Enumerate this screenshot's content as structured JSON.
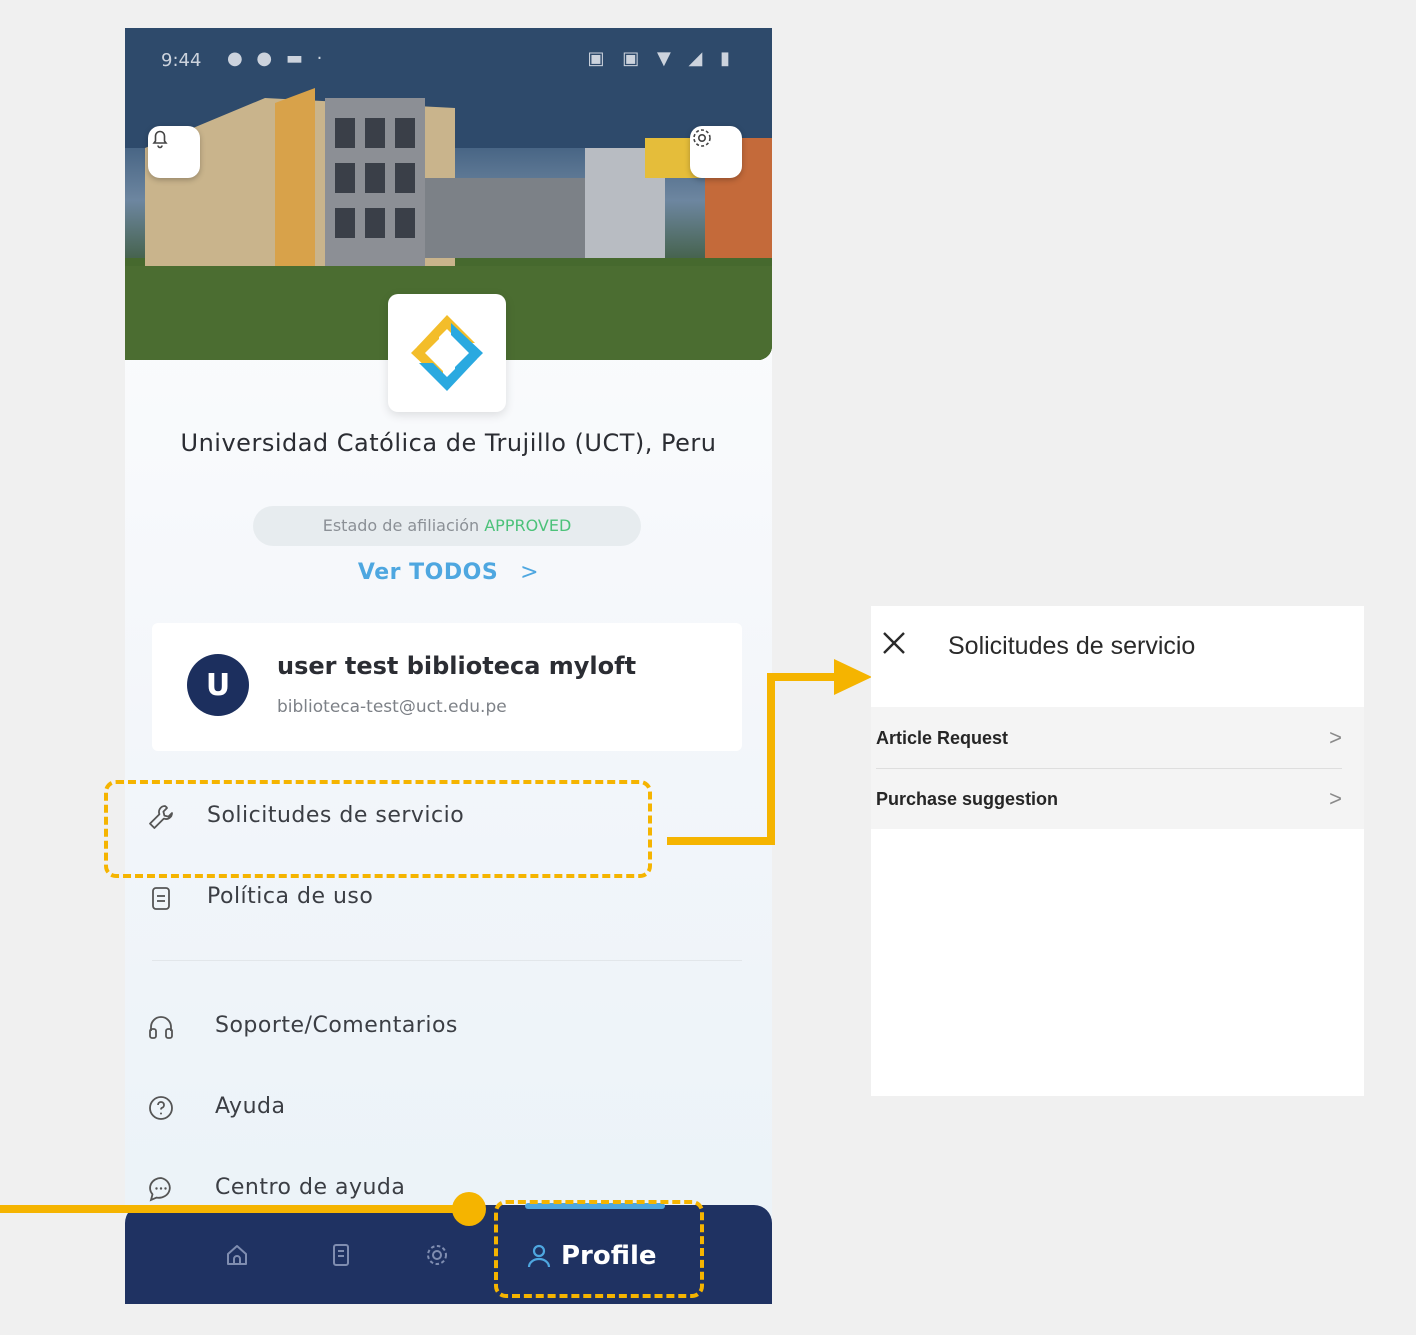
{
  "phone": {
    "status_time": "9:44",
    "institution_name": "Universidad Católica de Trujillo (UCT), Peru",
    "affiliation_label": "Estado de afiliación",
    "affiliation_status": "APPROVED",
    "see_all": "Ver TODOS",
    "see_all_chevron": ">",
    "user": {
      "initial": "U",
      "name": "user test biblioteca myloft",
      "email": "biblioteca-test@uct.edu.pe"
    },
    "menu": [
      {
        "label": "Solicitudes de servicio",
        "icon": "wrench-icon"
      },
      {
        "label": "Política de uso",
        "icon": "document-icon"
      },
      {
        "label": "Soporte/Comentarios",
        "icon": "headset-icon"
      },
      {
        "label": "Ayuda",
        "icon": "help-icon"
      },
      {
        "label": "Centro de ayuda",
        "icon": "chat-icon"
      }
    ],
    "bottom_nav": {
      "profile_label": "Profile",
      "tabs": [
        "home-icon",
        "book-icon",
        "gear-icon",
        "person-icon"
      ]
    }
  },
  "panel": {
    "title": "Solicitudes de servicio",
    "items": [
      {
        "label": "Article Request",
        "chevron": ">"
      },
      {
        "label": "Purchase suggestion",
        "chevron": ">"
      }
    ]
  },
  "colors": {
    "annotation": "#f5b400",
    "nav_background": "#1f3262",
    "accent_blue": "#4ea7e0",
    "approved_green": "#4cc27a"
  }
}
